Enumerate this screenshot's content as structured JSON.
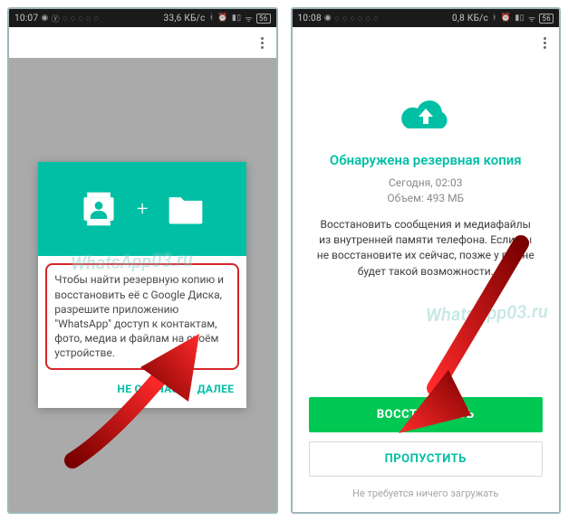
{
  "screen1": {
    "statusbar": {
      "time": "10:07",
      "speed": "33,6 КБ/с",
      "battery": "56"
    },
    "card": {
      "message": "Чтобы найти резервную копию и восстановить её с Google Диска, разрешите приложению \"WhatsApp\" доступ к контактам, фото, медиа и файлам на своём устройстве.",
      "not_now": "НЕ СЕЙЧАС",
      "next": "ДАЛЕЕ"
    },
    "watermark": "WhatsApp03.ru"
  },
  "screen2": {
    "statusbar": {
      "time": "10:08",
      "speed": "0,8 КБ/с",
      "battery": "56"
    },
    "title": "Обнаружена резервная копия",
    "meta_line1": "Сегодня, 02:03",
    "meta_line2": "Объем: 493 МБ",
    "description": "Восстановить сообщения и медиафайлы из внутренней памяти телефона. Если вы не восстановите их сейчас, позже у вас не будет такой возможности.",
    "restore": "ВОССТАНОВИТЬ",
    "skip": "ПРОПУСТИТЬ",
    "footer": "Не требуется ничего загружать",
    "watermark": "WhatsApp03.ru"
  }
}
